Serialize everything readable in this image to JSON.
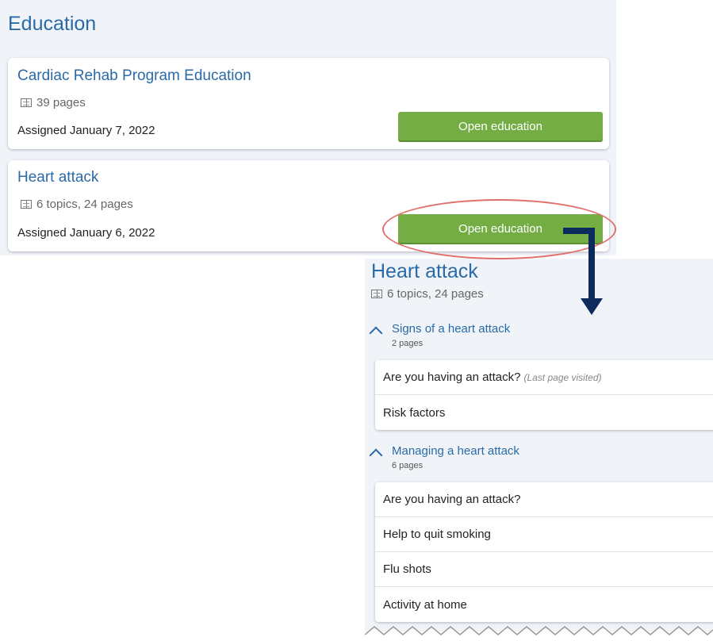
{
  "education": {
    "title": "Education",
    "cards": [
      {
        "title": "Cardiac Rehab Program Education",
        "meta": "39 pages",
        "assigned": "Assigned January 7, 2022",
        "button_label": "Open education"
      },
      {
        "title": "Heart attack",
        "meta": "6 topics, 24 pages",
        "assigned": "Assigned January 6, 2022",
        "button_label": "Open education"
      }
    ]
  },
  "topic": {
    "title": "Heart attack",
    "meta": "6 topics, 24 pages",
    "sections": [
      {
        "name": "Signs of a heart attack",
        "count": "2 pages",
        "items": [
          {
            "label": "Are you having an attack?",
            "note": "(Last page visited)"
          },
          {
            "label": "Risk factors"
          }
        ]
      },
      {
        "name": "Managing a heart attack",
        "count": "6 pages",
        "items": [
          {
            "label": "Are you having an attack?"
          },
          {
            "label": "Help to quit smoking"
          },
          {
            "label": "Flu shots"
          },
          {
            "label": "Activity at home"
          }
        ]
      }
    ]
  },
  "icons": {
    "book": "book-icon",
    "expand": "chevron-up-icon",
    "arrow": "arrow-down-icon"
  },
  "colors": {
    "accent": "#2a6aa6",
    "button": "#74ad44",
    "highlight": "#e0706b",
    "arrow": "#0d2a5c",
    "panel_bg": "#f0f4f9"
  }
}
